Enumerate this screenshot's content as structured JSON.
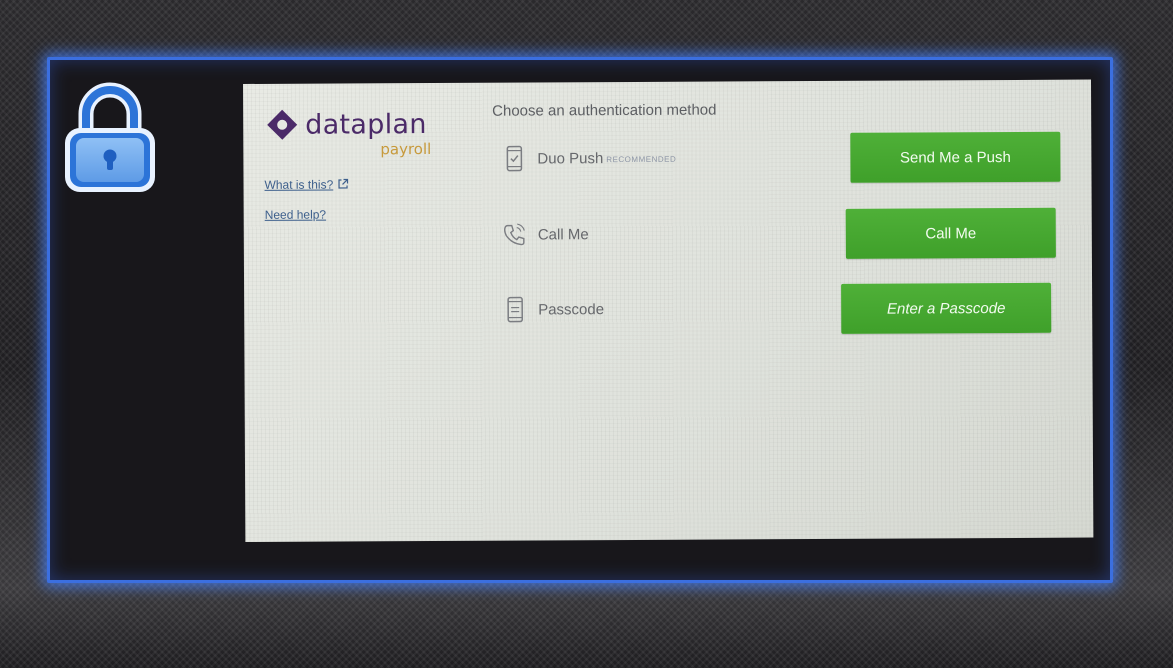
{
  "brand": {
    "name": "dataplan",
    "sub": "payroll",
    "accent": "#4b2a68",
    "sub_color": "#c79a3c"
  },
  "sidebar_links": {
    "what_is_this": "What is this?",
    "need_help": "Need help?"
  },
  "heading": "Choose an authentication method",
  "methods": [
    {
      "icon": "phone-check-icon",
      "label": "Duo Push",
      "badge": "RECOMMENDED",
      "button": "Send Me a Push"
    },
    {
      "icon": "phone-call-icon",
      "label": "Call Me",
      "button": "Call Me"
    },
    {
      "icon": "passcode-icon",
      "label": "Passcode",
      "button": "Enter a Passcode"
    }
  ],
  "colors": {
    "button_green": "#45a82f",
    "frame_glow": "#3b6fe0",
    "lock_blue": "#2c74d8"
  }
}
